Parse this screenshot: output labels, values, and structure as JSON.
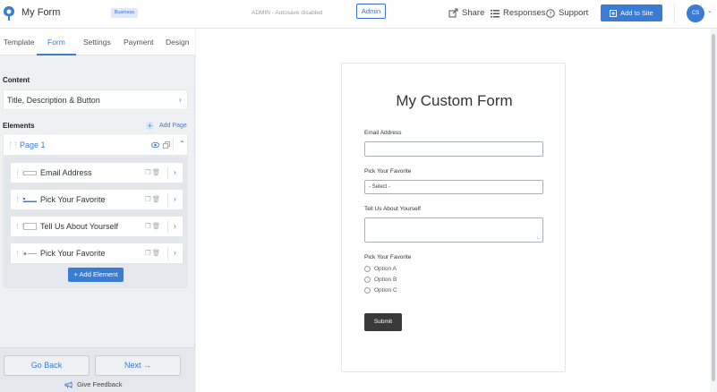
{
  "header": {
    "title": "My Form",
    "plan_badge": "Business",
    "autosave_status": "ADMIN - Autosave disabled",
    "admin_label": "Admin",
    "share_label": "Share",
    "responses_label": "Responses",
    "support_label": "Support",
    "add_to_site_label": "Add to Site",
    "avatar_initials": "CS"
  },
  "sidebar": {
    "tabs": [
      "Template",
      "Form",
      "Settings",
      "Payment",
      "Design"
    ],
    "active_tab": "Form",
    "content_heading": "Content",
    "content_item": "Title, Description & Button",
    "elements_heading": "Elements",
    "add_page_label": "Add Page",
    "page_label": "Page 1",
    "elements": [
      {
        "label": "Email Address",
        "type_icon": "text-input-icon"
      },
      {
        "label": "Pick Your Favorite",
        "type_icon": "dropdown-icon"
      },
      {
        "label": "Tell Us About Yourself",
        "type_icon": "textarea-icon"
      },
      {
        "label": "Pick Your Favorite",
        "type_icon": "radio-icon"
      }
    ],
    "add_element_label": "+ Add Element",
    "go_back_label": "Go Back",
    "next_label": "Next",
    "feedback_label": "Give Feedback"
  },
  "form_preview": {
    "title": "My Custom Form",
    "email_label": "Email Address",
    "select_label": "Pick Your Favorite",
    "select_value": "- Select -",
    "textarea_label": "Tell Us About Yourself",
    "radio_label": "Pick Your Favorite",
    "radio_options": [
      "Option A",
      "Option B",
      "Option C"
    ],
    "submit_label": "Submit"
  },
  "colors": {
    "accent": "#3a7bd5",
    "submit": "#3a3a3a"
  }
}
